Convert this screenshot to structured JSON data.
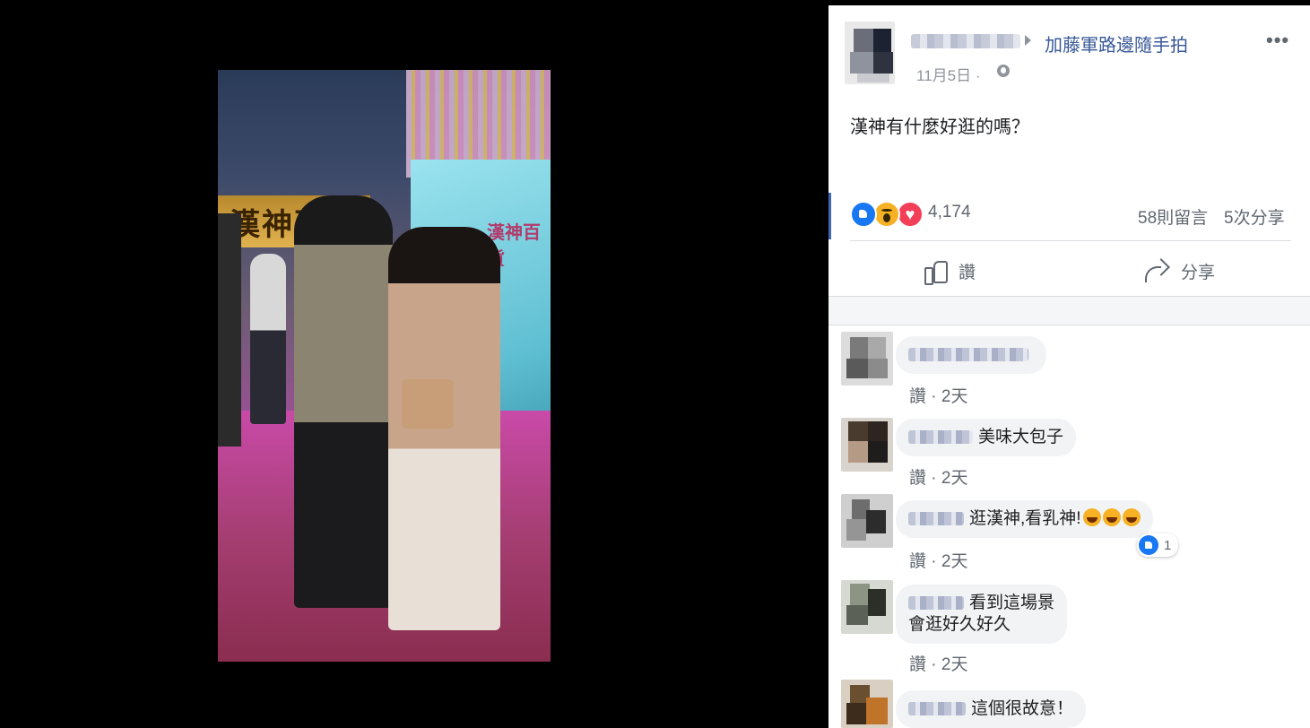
{
  "photo": {
    "sign_text": "漢神百貨",
    "board_text": "漢神百貨"
  },
  "post": {
    "group_name": "加藤軍路邊隨手拍",
    "time": "11月5日 ·",
    "text": "漢神有什麼好逛的嗎？",
    "more_label": "•••",
    "reaction_count": "4,174",
    "reaction_types": [
      "like",
      "wow",
      "love"
    ],
    "comments_count": "58則留言",
    "shares_count": "5次分享",
    "like_action": "讚",
    "share_action": "分享"
  },
  "comments": [
    {
      "text": "",
      "like_label": "讚 ·",
      "time": "2天"
    },
    {
      "text": "美味大包子",
      "like_label": "讚 ·",
      "time": "2天"
    },
    {
      "text": "逛漢神,看乳神!",
      "like_label": "讚 ·",
      "time": "2天",
      "emoji_icon": "rolling-laughing-icon",
      "reaction_count": "1"
    },
    {
      "text_line1": "看到這場景",
      "text_line2": "會逛好久好久",
      "like_label": "讚 ·",
      "time": "2天"
    },
    {
      "text": "這個很故意！"
    }
  ],
  "colors": {
    "link_blue": "#385898",
    "like_blue": "#1877f2",
    "wow_yellow": "#f7b125",
    "love_red": "#f33e58",
    "secondary_text": "#606770",
    "bubble_bg": "#f2f3f5"
  }
}
